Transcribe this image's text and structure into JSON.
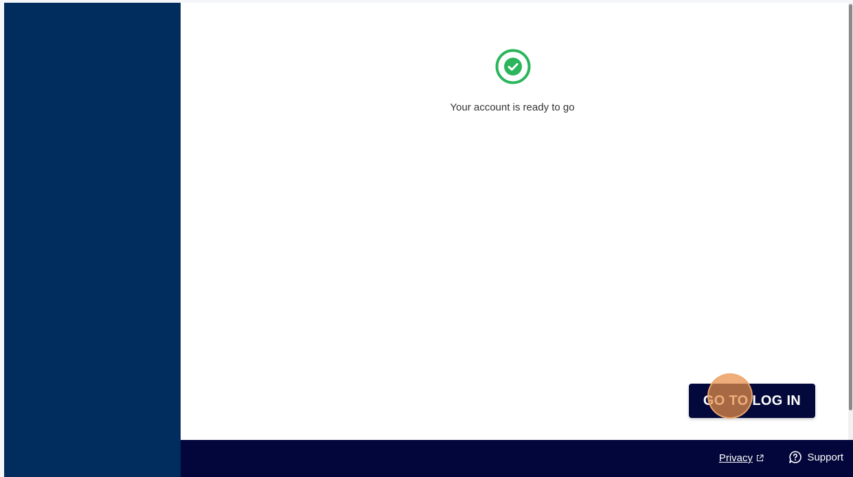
{
  "colors": {
    "sidebar": "#002d5e",
    "footer": "#03063a",
    "button": "#03093a",
    "success": "#2bb55c"
  },
  "main": {
    "icon": "check-circle-icon",
    "status_text": "Your account is ready to go",
    "login_button": "GO TO LOG IN"
  },
  "footer": {
    "privacy_label": "Privacy",
    "privacy_icon": "external-link-icon",
    "support_label": "Support",
    "support_icon": "chat-question-icon"
  }
}
